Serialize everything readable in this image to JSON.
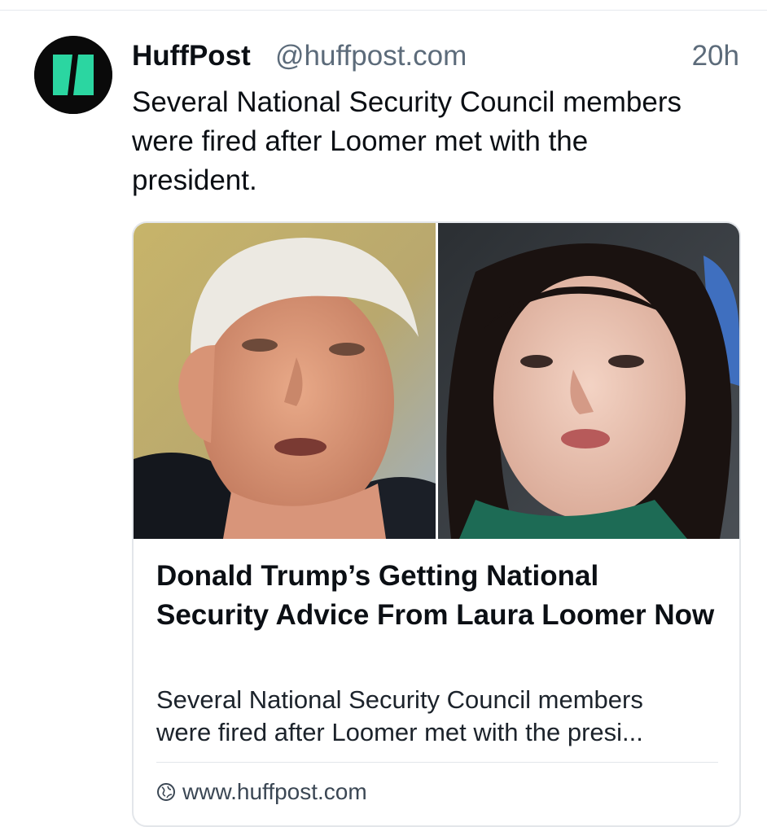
{
  "post": {
    "author_name": "HuffPost",
    "author_handle": "@huffpost.com",
    "timestamp": "20h",
    "text": "Several National Security Council members were fired after Loomer met with the president.",
    "avatar_icon": "huffpost-logo-icon",
    "brand_color": "#2bd6a1"
  },
  "link_card": {
    "title": "Donald Trump’s Getting National Security Advice From Laura Loomer Now",
    "description_line1": "Several National Security Council members",
    "description_line2": "were fired after Loomer met with the presi...",
    "domain": "www.huffpost.com",
    "domain_icon": "globe-icon",
    "image_description_left": "photo-left",
    "image_description_right": "photo-right"
  }
}
